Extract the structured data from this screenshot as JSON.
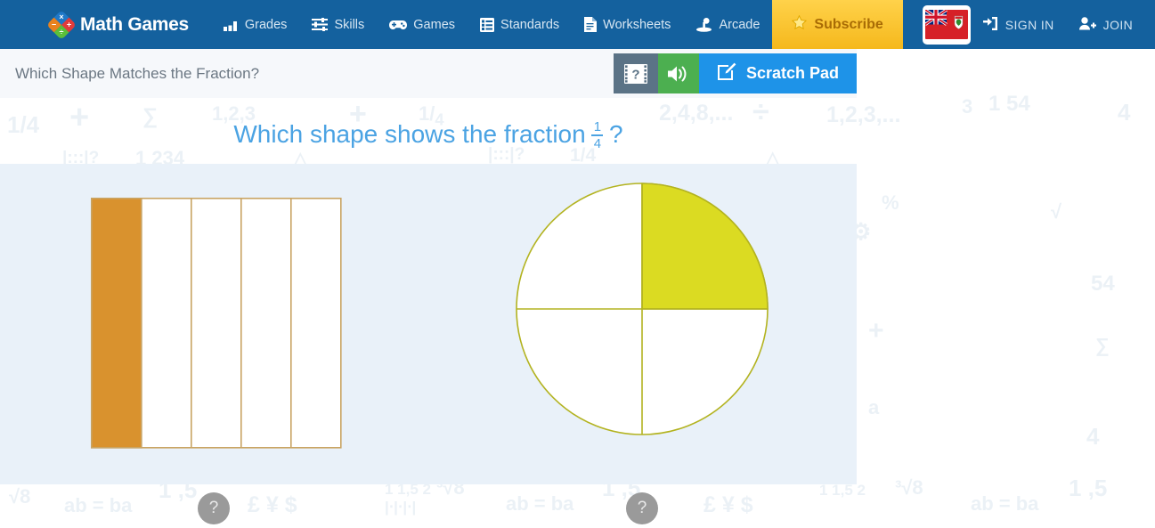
{
  "brand": {
    "name": "Math Games",
    "logo_colors": {
      "red": "#e23b3b",
      "blue": "#1f78c8",
      "orange": "#e8821e",
      "green": "#5bbf3a"
    },
    "logo_symbols": {
      "top": "+",
      "left": "×",
      "right": "÷",
      "bottom": "−"
    },
    "header_bg": "#14619e"
  },
  "nav": {
    "items": [
      {
        "label": "Grades",
        "icon": "bar-chart-icon"
      },
      {
        "label": "Skills",
        "icon": "sliders-icon"
      },
      {
        "label": "Games",
        "icon": "gamepad-icon"
      },
      {
        "label": "Standards",
        "icon": "list-icon"
      },
      {
        "label": "Worksheets",
        "icon": "document-icon"
      },
      {
        "label": "Arcade",
        "icon": "joystick-icon"
      }
    ],
    "subscribe": {
      "label": "Subscribe",
      "icon": "star-icon",
      "bg": "#f5b81c",
      "color": "#a96c05"
    },
    "flag": {
      "name": "ontario-flag",
      "alt": "Ontario"
    },
    "sign_in": {
      "label": "SIGN IN",
      "icon": "sign-in-icon"
    },
    "join": {
      "label": "JOIN",
      "icon": "user-plus-icon"
    }
  },
  "toolbar": {
    "activity_title": "Which Shape Matches the Fraction?",
    "video_help": {
      "icon": "film-question-icon",
      "bg": "#5b7386"
    },
    "audio": {
      "icon": "speaker-icon",
      "bg": "#4caf50"
    },
    "scratch_pad": {
      "label": "Scratch Pad",
      "icon": "pencil-square-icon",
      "bg": "#1e93e8"
    }
  },
  "question": {
    "prefix": "Which shape shows the fraction",
    "numerator": "1",
    "denominator": "4",
    "suffix": "?",
    "color": "#4ba3e3"
  },
  "answers": {
    "panel_bg": "#e9f1f9",
    "hint_label": "?",
    "choices": [
      {
        "id": "choice-a",
        "shape": "rectangle",
        "parts": 5,
        "shaded": 1,
        "fraction": "1/5",
        "fill_color": "#d9922e",
        "stroke_color": "#c9a463",
        "correct": false
      },
      {
        "id": "choice-b",
        "shape": "circle",
        "parts": 4,
        "shaded": 1,
        "fraction": "1/4",
        "fill_color": "#dbdb22",
        "stroke_color": "#b3b320",
        "correct": true
      }
    ]
  },
  "watermark": {
    "color": "#dbe6f0",
    "tokens": [
      "1/4",
      "+",
      "2,4,8,...",
      "÷",
      "1,2,3,...",
      "1 234",
      "ab = ba",
      "³√8",
      "1,5",
      "£",
      "¥",
      "$",
      "×",
      "−",
      "3 54",
      "∆",
      "%",
      "1 1/2"
    ]
  }
}
